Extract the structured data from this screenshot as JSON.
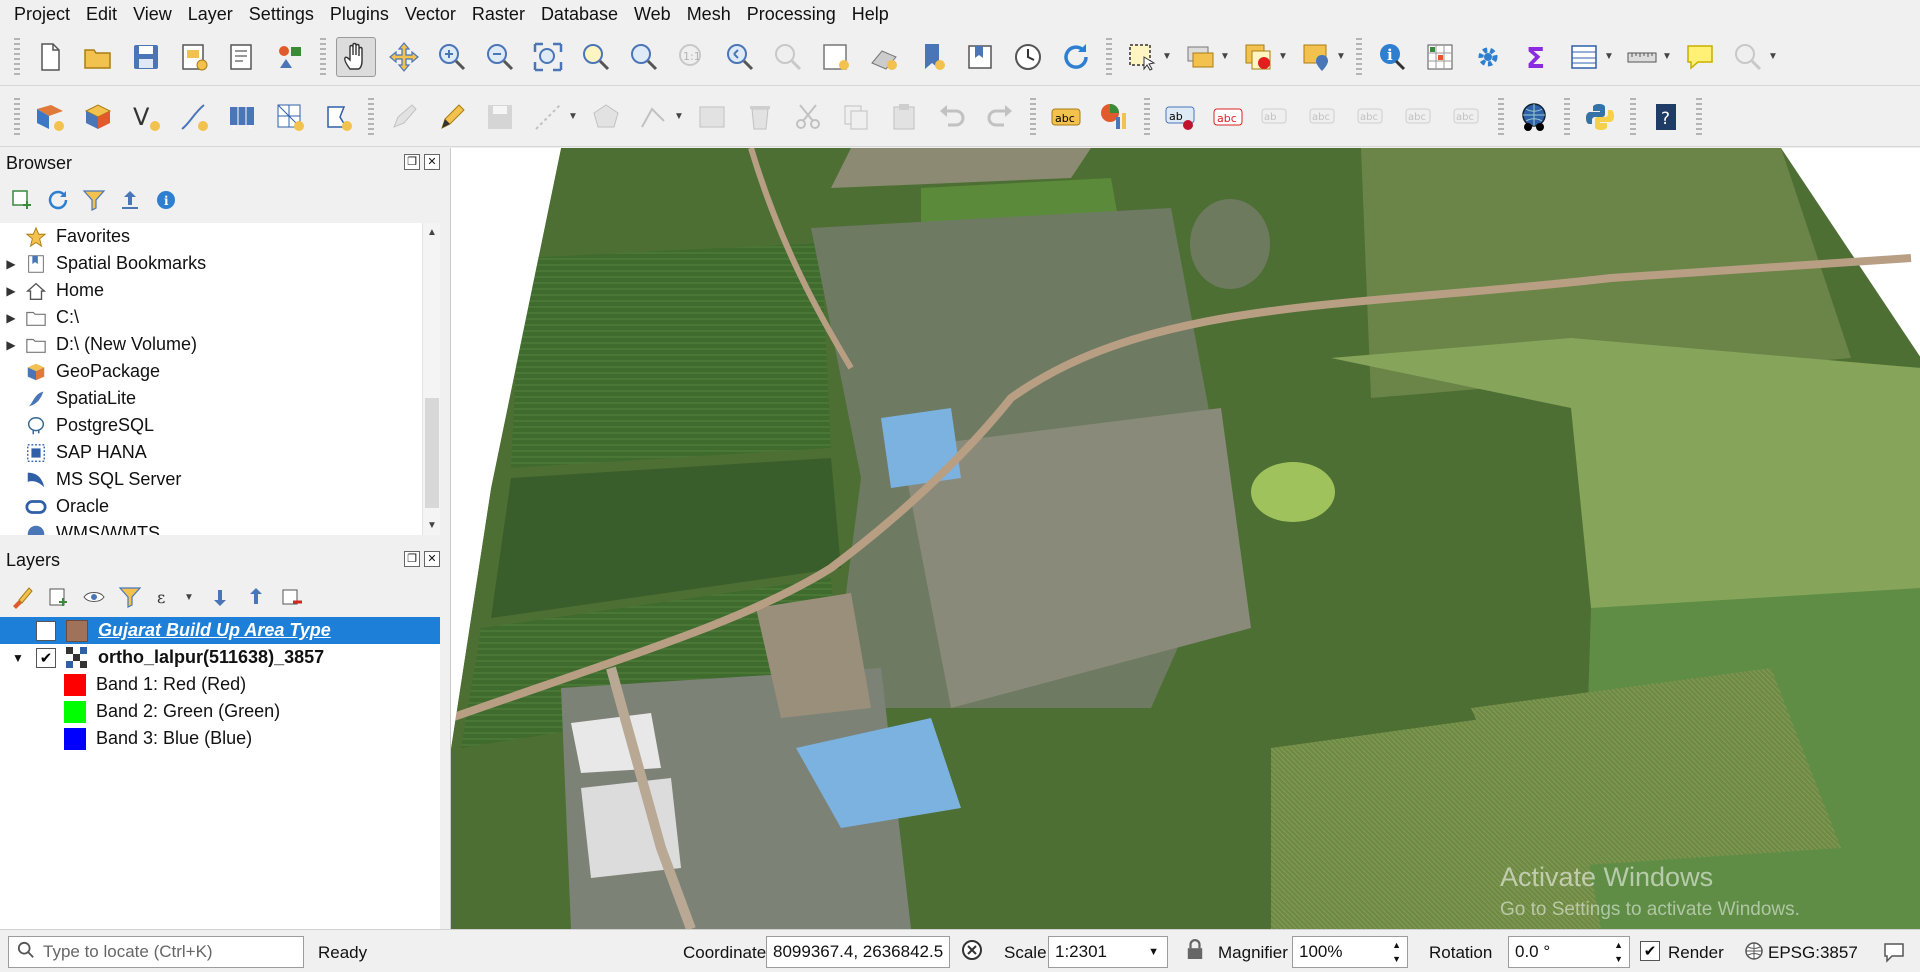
{
  "menu": [
    "Project",
    "Edit",
    "View",
    "Layer",
    "Settings",
    "Plugins",
    "Vector",
    "Raster",
    "Database",
    "Web",
    "Mesh",
    "Processing",
    "Help"
  ],
  "browser": {
    "title": "Browser",
    "items": [
      {
        "label": "Favorites",
        "icon": "star-icon",
        "expand": ""
      },
      {
        "label": "Spatial Bookmarks",
        "icon": "bookmark-icon",
        "expand": "▶"
      },
      {
        "label": "Home",
        "icon": "home-icon",
        "expand": "▶"
      },
      {
        "label": "C:\\",
        "icon": "folder-icon",
        "expand": "▶"
      },
      {
        "label": "D:\\ (New Volume)",
        "icon": "folder-icon",
        "expand": "▶"
      },
      {
        "label": "GeoPackage",
        "icon": "geopackage-icon",
        "expand": ""
      },
      {
        "label": "SpatiaLite",
        "icon": "spatialite-icon",
        "expand": ""
      },
      {
        "label": "PostgreSQL",
        "icon": "postgresql-icon",
        "expand": ""
      },
      {
        "label": "SAP HANA",
        "icon": "sap-hana-icon",
        "expand": ""
      },
      {
        "label": "MS SQL Server",
        "icon": "mssql-icon",
        "expand": ""
      },
      {
        "label": "Oracle",
        "icon": "oracle-icon",
        "expand": ""
      },
      {
        "label": "WMS/WMTS",
        "icon": "wms-icon",
        "expand": ""
      }
    ]
  },
  "layers": {
    "title": "Layers",
    "items": [
      {
        "label": "Gujarat Build Up Area Type",
        "checked": false,
        "selected": true,
        "color": "#a0725a"
      },
      {
        "label": "ortho_lalpur(511638)_3857",
        "checked": true,
        "selected": false
      },
      {
        "label": "Band 1: Red (Red)",
        "color": "#ff0000"
      },
      {
        "label": "Band 2: Green (Green)",
        "color": "#00ff00"
      },
      {
        "label": "Band 3: Blue (Blue)",
        "color": "#0000ff"
      }
    ]
  },
  "watermark": {
    "line1": "Activate Windows",
    "line2": "Go to Settings to activate Windows."
  },
  "status": {
    "locator_placeholder": "Type to locate (Ctrl+K)",
    "ready": "Ready",
    "coordinate_label": "Coordinate",
    "coordinate_value": "8099367.4, 2636842.5",
    "scale_label": "Scale",
    "scale_value": "1:2301",
    "magnifier_label": "Magnifier",
    "magnifier_value": "100%",
    "rotation_label": "Rotation",
    "rotation_value": "0.0 °",
    "render_label": "Render",
    "crs": "EPSG:3857"
  }
}
